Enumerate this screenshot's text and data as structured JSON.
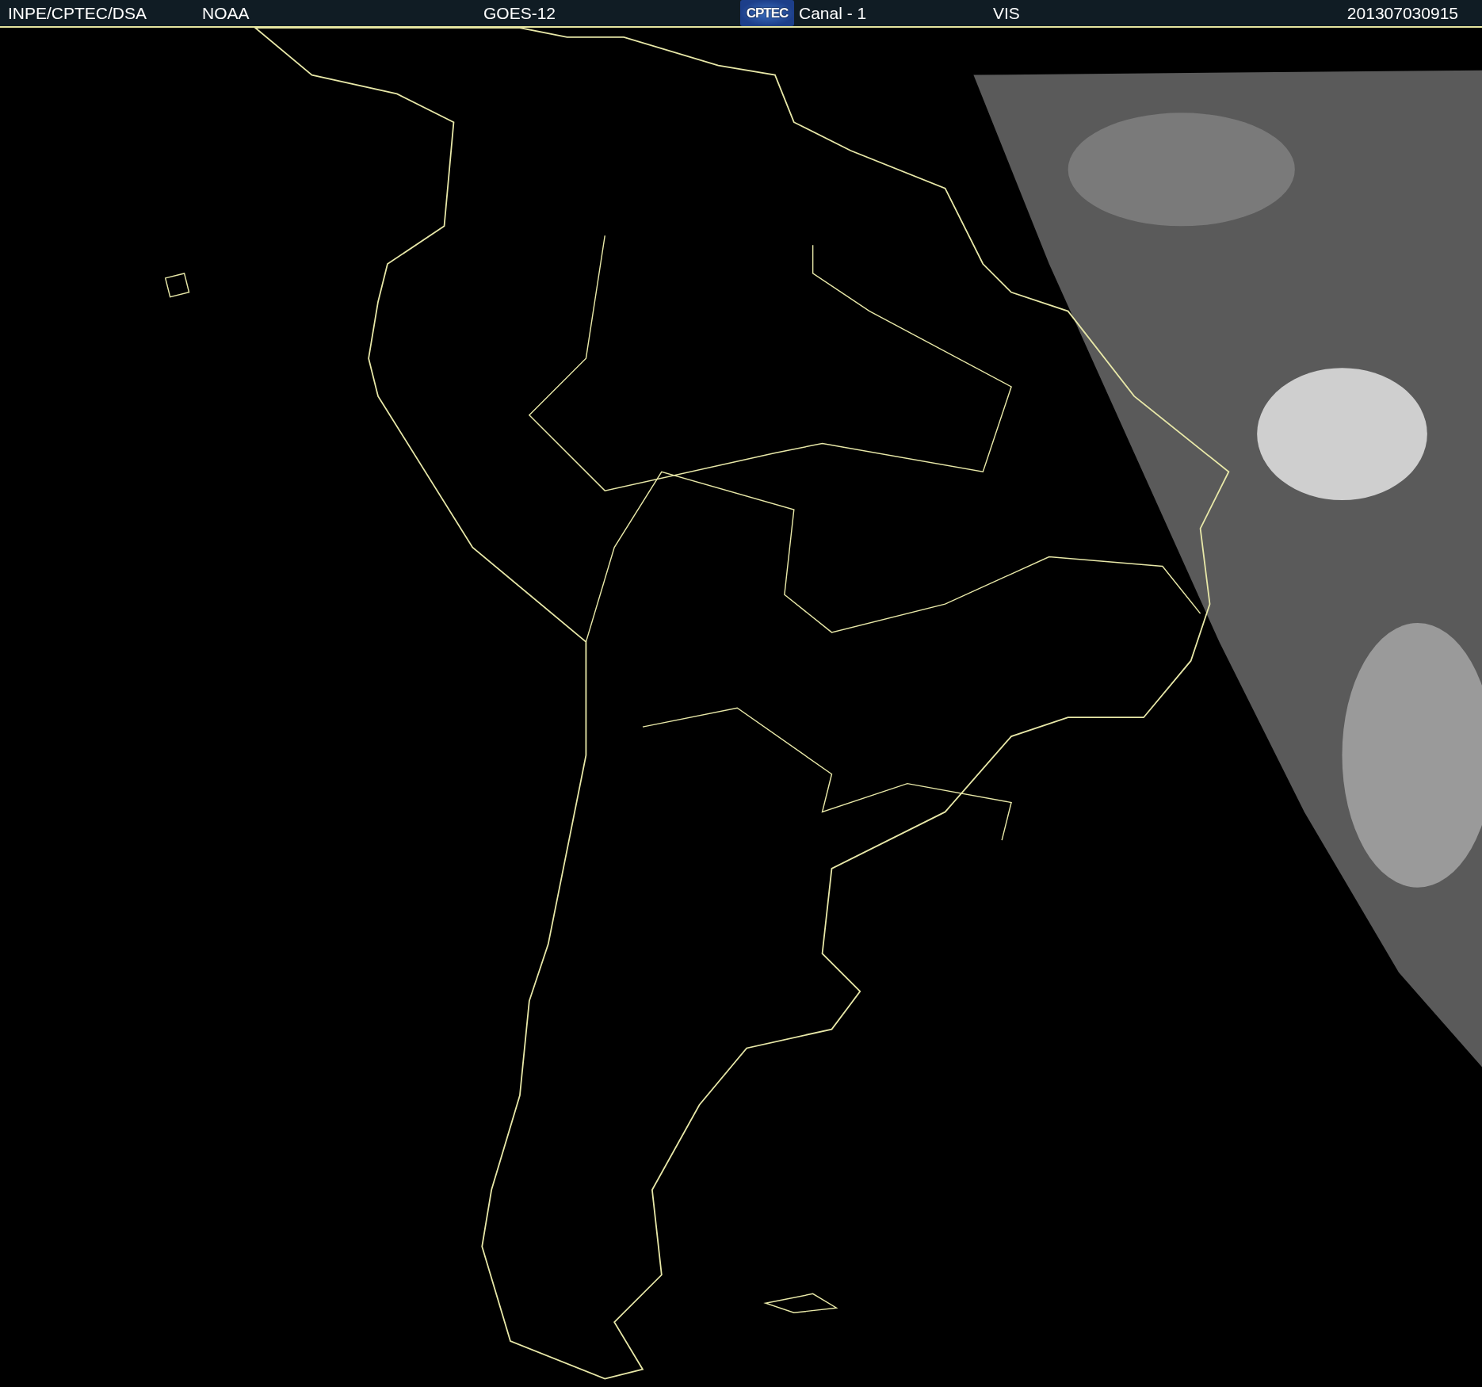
{
  "header": {
    "source": "INPE/CPTEC/DSA",
    "agency": "NOAA",
    "satellite": "GOES-12",
    "logo": "CPTEC",
    "channel": "Canal - 1",
    "band": "VIS",
    "timestamp": "201307030915"
  }
}
